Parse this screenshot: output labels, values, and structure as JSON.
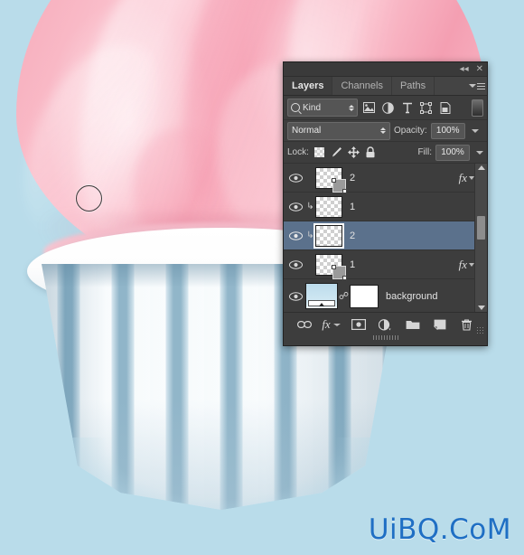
{
  "canvas": {
    "background_color": "#b9dcea",
    "artwork_name": "pink-frosted-cupcake",
    "brush_cursor_label": "brush-cursor"
  },
  "watermark": {
    "text": "UiBQ.CoM",
    "color": "#1f6fc4"
  },
  "panel": {
    "titlebar": {
      "collapse_icon": "◂◂",
      "close_icon": "✕"
    },
    "tabs": [
      {
        "label": "Layers",
        "active": true
      },
      {
        "label": "Channels",
        "active": false
      },
      {
        "label": "Paths",
        "active": false
      }
    ],
    "filter_bar": {
      "kind_label": "Kind",
      "icons": [
        "pixel-filter-icon",
        "adjustment-filter-icon",
        "type-filter-icon",
        "shape-filter-icon",
        "smart-object-filter-icon"
      ],
      "toggle_name": "filter-enable-toggle"
    },
    "blend_bar": {
      "blend_mode": "Normal",
      "opacity_label": "Opacity:",
      "opacity_value": "100%"
    },
    "lock_bar": {
      "lock_label": "Lock:",
      "lock_icons": [
        "lock-transparent-pixels-icon",
        "lock-image-pixels-icon",
        "lock-position-icon",
        "lock-all-icon"
      ],
      "fill_label": "Fill:",
      "fill_value": "100%"
    },
    "layers": [
      {
        "name": "2",
        "visible": true,
        "clipped": false,
        "selected": false,
        "has_fx": true,
        "kind": "shape",
        "thumb": "checker"
      },
      {
        "name": "1",
        "visible": true,
        "clipped": true,
        "selected": false,
        "has_fx": false,
        "kind": "pixel",
        "thumb": "checker"
      },
      {
        "name": "2",
        "visible": true,
        "clipped": true,
        "selected": true,
        "has_fx": false,
        "kind": "pixel",
        "thumb": "checker"
      },
      {
        "name": "1",
        "visible": true,
        "clipped": false,
        "selected": false,
        "has_fx": true,
        "kind": "shape",
        "thumb": "checker"
      },
      {
        "name": "background",
        "visible": true,
        "clipped": false,
        "selected": false,
        "has_fx": false,
        "kind": "gradient-with-mask",
        "thumb": "gradient"
      }
    ],
    "bottom_bar": {
      "buttons": [
        "link-layers-button",
        "add-layer-style-button",
        "add-layer-mask-button",
        "new-adjustment-layer-button",
        "new-group-button",
        "new-layer-button",
        "delete-layer-button"
      ],
      "fx_label": "fx"
    }
  }
}
